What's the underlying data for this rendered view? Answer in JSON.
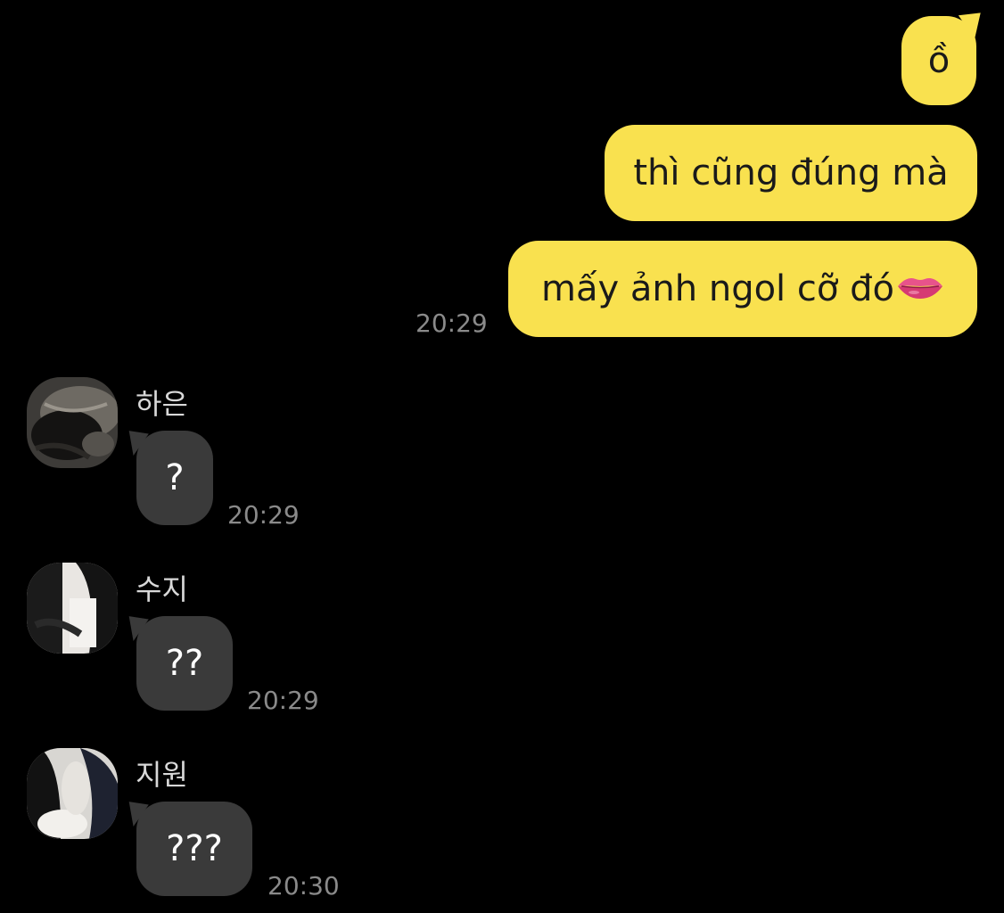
{
  "outgoing": [
    {
      "text": "ồ"
    },
    {
      "text": "thì cũng đúng mà"
    },
    {
      "text": "mấy ảnh ngol cỡ đó",
      "emoji_icon": "lips-icon",
      "time": "20:29"
    }
  ],
  "incoming": [
    {
      "sender": "하은",
      "text": "?",
      "time": "20:29"
    },
    {
      "sender": "수지",
      "text": "??",
      "time": "20:29"
    },
    {
      "sender": "지원",
      "text": "???",
      "time": "20:30"
    }
  ],
  "colors": {
    "background": "#000000",
    "outgoing_bubble": "#f9e14f",
    "incoming_bubble": "#3a3a3a",
    "timestamp": "#8a8a8a",
    "sender_name": "#d8d8d8"
  }
}
